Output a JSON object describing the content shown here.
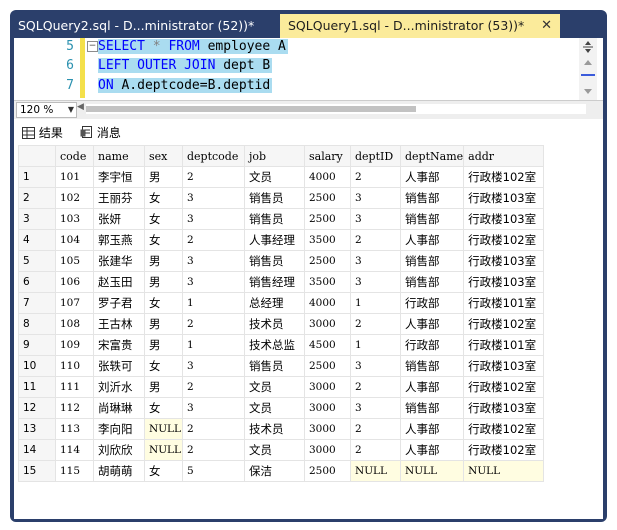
{
  "tabs": [
    {
      "title": "SQLQuery2.sql - D...ministrator (52))*",
      "active": false
    },
    {
      "title": "SQLQuery1.sql - D...ministrator (53))*",
      "active": true
    }
  ],
  "close_glyph": "✕",
  "editor": {
    "line_numbers": [
      "5",
      "6",
      "7"
    ],
    "line5": {
      "kw1": "SELECT",
      "op": "*",
      "kw2": "FROM",
      "rest": "employee A"
    },
    "line6": {
      "kw1": "LEFT OUTER JOIN",
      "rest": "dept B"
    },
    "line7": {
      "kw1": "ON",
      "rest": "A.deptcode=B.deptid"
    }
  },
  "zoom": "120 %",
  "results_tabs": {
    "results": "结果",
    "messages": "消息"
  },
  "columns": [
    "",
    "code",
    "name",
    "sex",
    "deptcode",
    "job",
    "salary",
    "deptID",
    "deptName",
    "addr"
  ],
  "rows": [
    [
      "1",
      "101",
      "李宇恒",
      "男",
      "2",
      "文员",
      "4000",
      "2",
      "人事部",
      "行政楼102室"
    ],
    [
      "2",
      "102",
      "王丽芬",
      "女",
      "3",
      "销售员",
      "2500",
      "3",
      "销售部",
      "行政楼103室"
    ],
    [
      "3",
      "103",
      "张妍",
      "女",
      "3",
      "销售员",
      "2500",
      "3",
      "销售部",
      "行政楼103室"
    ],
    [
      "4",
      "104",
      "郭玉燕",
      "女",
      "2",
      "人事经理",
      "3500",
      "2",
      "人事部",
      "行政楼102室"
    ],
    [
      "5",
      "105",
      "张建华",
      "男",
      "3",
      "销售员",
      "2500",
      "3",
      "销售部",
      "行政楼103室"
    ],
    [
      "6",
      "106",
      "赵玉田",
      "男",
      "3",
      "销售经理",
      "3500",
      "3",
      "销售部",
      "行政楼103室"
    ],
    [
      "7",
      "107",
      "罗子君",
      "女",
      "1",
      "总经理",
      "4000",
      "1",
      "行政部",
      "行政楼101室"
    ],
    [
      "8",
      "108",
      "王古林",
      "男",
      "2",
      "技术员",
      "3000",
      "2",
      "人事部",
      "行政楼102室"
    ],
    [
      "9",
      "109",
      "宋富贵",
      "男",
      "1",
      "技术总监",
      "4500",
      "1",
      "行政部",
      "行政楼101室"
    ],
    [
      "10",
      "110",
      "张轶可",
      "女",
      "3",
      "销售员",
      "2500",
      "3",
      "销售部",
      "行政楼103室"
    ],
    [
      "11",
      "111",
      "刘沂水",
      "男",
      "2",
      "文员",
      "3000",
      "2",
      "人事部",
      "行政楼102室"
    ],
    [
      "12",
      "112",
      "尚琳琳",
      "女",
      "3",
      "文员",
      "3000",
      "3",
      "销售部",
      "行政楼103室"
    ],
    [
      "13",
      "113",
      "李向阳",
      "NULL",
      "2",
      "技术员",
      "3000",
      "2",
      "人事部",
      "行政楼102室"
    ],
    [
      "14",
      "114",
      "刘欣欣",
      "NULL",
      "2",
      "文员",
      "3000",
      "2",
      "人事部",
      "行政楼102室"
    ],
    [
      "15",
      "115",
      "胡萌萌",
      "女",
      "5",
      "保洁",
      "2500",
      "NULL",
      "NULL",
      "NULL"
    ]
  ],
  "colors": {
    "frame": "#2b3f6b",
    "active_tab": "#fbeb9b",
    "keyword": "#0000ff",
    "selection": "#aadcf0",
    "null_bg": "#fffde1"
  }
}
